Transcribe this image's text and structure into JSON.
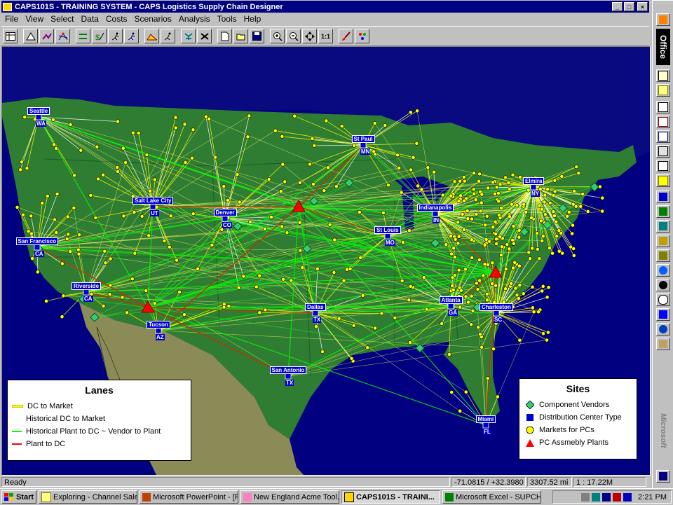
{
  "window": {
    "title": "CAPS101S - TRAINING SYSTEM - CAPS Logistics Supply Chain Designer"
  },
  "menu": [
    "File",
    "View",
    "Select",
    "Data",
    "Costs",
    "Scenarios",
    "Analysis",
    "Tools",
    "Help"
  ],
  "toolbar": {
    "icons": [
      "table-icon",
      "mountain-icon",
      "route-icon",
      "network-icon",
      "swap-icon",
      "cost-icon",
      "runner-icon",
      "runner-icon-2",
      "hill-icon",
      "runner-icon-3",
      "tree-icon",
      "tool-icon",
      "new-file-icon",
      "open-folder-icon",
      "save-icon",
      "zoom-in-icon",
      "zoom-out-icon",
      "pan-icon",
      "zoom-1-1-icon",
      "brush-icon",
      "palette-icon"
    ],
    "zoom_label": "1:1"
  },
  "map": {
    "cities": [
      {
        "name": "Seattle",
        "code": "WA"
      },
      {
        "name": "St Paul",
        "code": "MN"
      },
      {
        "name": "Elmira",
        "code": "NY"
      },
      {
        "name": "Salt Lake City",
        "code": "UT"
      },
      {
        "name": "Denver",
        "code": "CO"
      },
      {
        "name": "Indianapolis",
        "code": "IN"
      },
      {
        "name": "San Francisco",
        "code": "CA"
      },
      {
        "name": "St Louis",
        "code": "MO"
      },
      {
        "name": "Riverside",
        "code": "CA"
      },
      {
        "name": "Atlanta",
        "code": "GA"
      },
      {
        "name": "Charleston",
        "code": "SC"
      },
      {
        "name": "Dallas",
        "code": "TX"
      },
      {
        "name": "Tucson",
        "code": "AZ"
      },
      {
        "name": "San Antonio",
        "code": "TX"
      },
      {
        "name": "Miami",
        "code": "FL"
      }
    ]
  },
  "lanes_legend": {
    "title": "Lanes",
    "items": [
      {
        "label": "DC to Market",
        "color": "#ffff00"
      },
      {
        "label": "Historical DC to Market",
        "color": "#ffffff"
      },
      {
        "label": "Historical Plant to DC  ~  Vendor to Plant",
        "color": "#00ff00"
      },
      {
        "label": "Plant to DC",
        "color": "#ff0000"
      }
    ]
  },
  "sites_legend": {
    "title": "Sites",
    "items": [
      {
        "label": "Component Vendors",
        "marker": "diamond",
        "color": "#33cc77"
      },
      {
        "label": "Distribution Center Type",
        "marker": "square",
        "color": "#0000cc"
      },
      {
        "label": "Markets for PCs",
        "marker": "circle",
        "color": "#ffff00"
      },
      {
        "label": "PC Assmebly Plants",
        "marker": "triangle",
        "color": "#ff0000"
      }
    ]
  },
  "status": {
    "text": "Ready",
    "coords": "-71.0815 / +32.3980",
    "distance": "3307.52 mi",
    "scale": "1 : 17.22M"
  },
  "taskbar": {
    "start": "Start",
    "tasks": [
      "Exploring - Channel Sale...",
      "Microsoft PowerPoint - [P...",
      "New England Acme Tool...",
      "CAPS101S - TRAINI...",
      "Microsoft Excel - SUPCH..."
    ],
    "clock": "2:21 PM"
  },
  "office_bar": {
    "label": "Office",
    "brand": "Microsoft"
  }
}
